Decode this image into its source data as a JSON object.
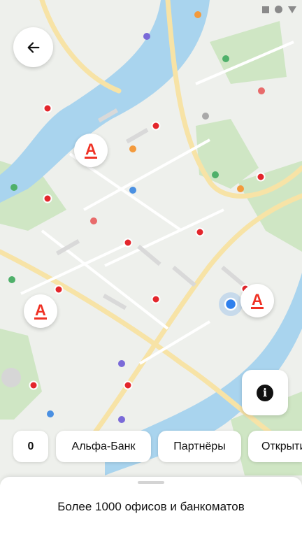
{
  "header": {
    "back_icon": "arrow-left-icon"
  },
  "map": {
    "bank_marker_letter": "А",
    "brand_color": "#ef3124",
    "user_location_color": "#2f80ed"
  },
  "filters": {
    "count": "0",
    "chips": [
      "Альфа-Банк",
      "Партнёры",
      "Открытие"
    ]
  },
  "info_button": {
    "icon": "info-icon"
  },
  "bottom_sheet": {
    "title": "Более 1000 офисов и банкоматов"
  }
}
